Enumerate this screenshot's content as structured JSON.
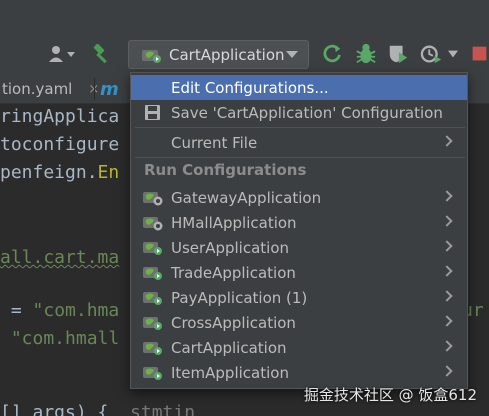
{
  "toolbar": {
    "run_config_label": "CartApplication",
    "icons": [
      "user-icon",
      "hammer-icon",
      "spring-boot-config-icon",
      "chevron-down-icon",
      "rerun-icon",
      "debug-icon",
      "coverage-icon",
      "profile-icon",
      "stop-icon"
    ]
  },
  "tabs": [
    {
      "label": "tion.yaml",
      "close": "×"
    },
    {
      "label": "m"
    }
  ],
  "editor": {
    "lines": [
      {
        "text": "ringApplica"
      },
      {
        "text": "toconfigure"
      },
      {
        "text_a": "penfeign.",
        "text_b": "En"
      },
      {
        "text": ""
      },
      {
        "text": "all.cart.ma"
      },
      {
        "text": ""
      },
      {
        "text_a": " = ",
        "text_b": "\"com.hma",
        "text_c": "ur"
      },
      {
        "text": " \"com.hmall"
      },
      {
        "text": ""
      },
      {
        "text_a": "[] args) {",
        "text_b": "  stmtin"
      }
    ]
  },
  "menu": {
    "items": [
      {
        "label": "Edit Configurations...",
        "selected": true
      },
      {
        "label": "Save 'CartApplication' Configuration",
        "icon": "save-icon"
      },
      {
        "label": "Current File",
        "submenu": true
      }
    ],
    "section_title": "Run Configurations",
    "run_configs": [
      {
        "label": "GatewayApplication"
      },
      {
        "label": "HMallApplication"
      },
      {
        "label": "UserApplication"
      },
      {
        "label": "TradeApplication"
      },
      {
        "label": "PayApplication (1)"
      },
      {
        "label": "CrossApplication"
      },
      {
        "label": "CartApplication"
      },
      {
        "label": "ItemApplication"
      }
    ]
  },
  "watermark": "掘金技术社区 @ 饭盒612",
  "colors": {
    "selection": "#4b6eaf",
    "menu_bg": "#3c3f41",
    "editor_bg": "#2b2b2b",
    "spring_green": "#6db33f",
    "run_green": "#59a869"
  }
}
